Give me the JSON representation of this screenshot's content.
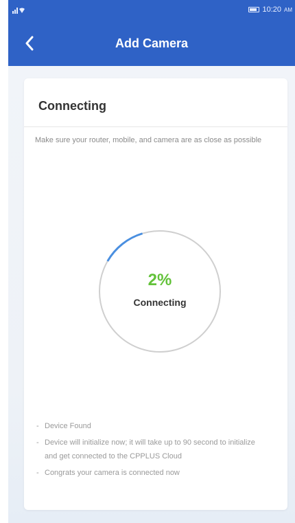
{
  "status_bar": {
    "signal": "▐▐",
    "time": "10:20",
    "am_pm": "AM"
  },
  "header": {
    "title": "Add Camera",
    "back_icon": "chevron-left-icon"
  },
  "card": {
    "title": "Connecting",
    "hint": "Make sure your router, mobile, and camera are as close as possible",
    "progress": {
      "percent": 2,
      "percent_text": "2%",
      "label": "Connecting",
      "track_color": "#cfcfcf",
      "fill_color": "#4a8fe0",
      "text_color": "#63c23a"
    },
    "steps": [
      "Device Found",
      "Device will initialize now; it will take up to 90 second to initialize and get connected to the CPPLUS Cloud",
      "Congrats your camera is connected now"
    ]
  },
  "colors": {
    "primary": "#2f62c6",
    "background": "#eef2f7"
  }
}
